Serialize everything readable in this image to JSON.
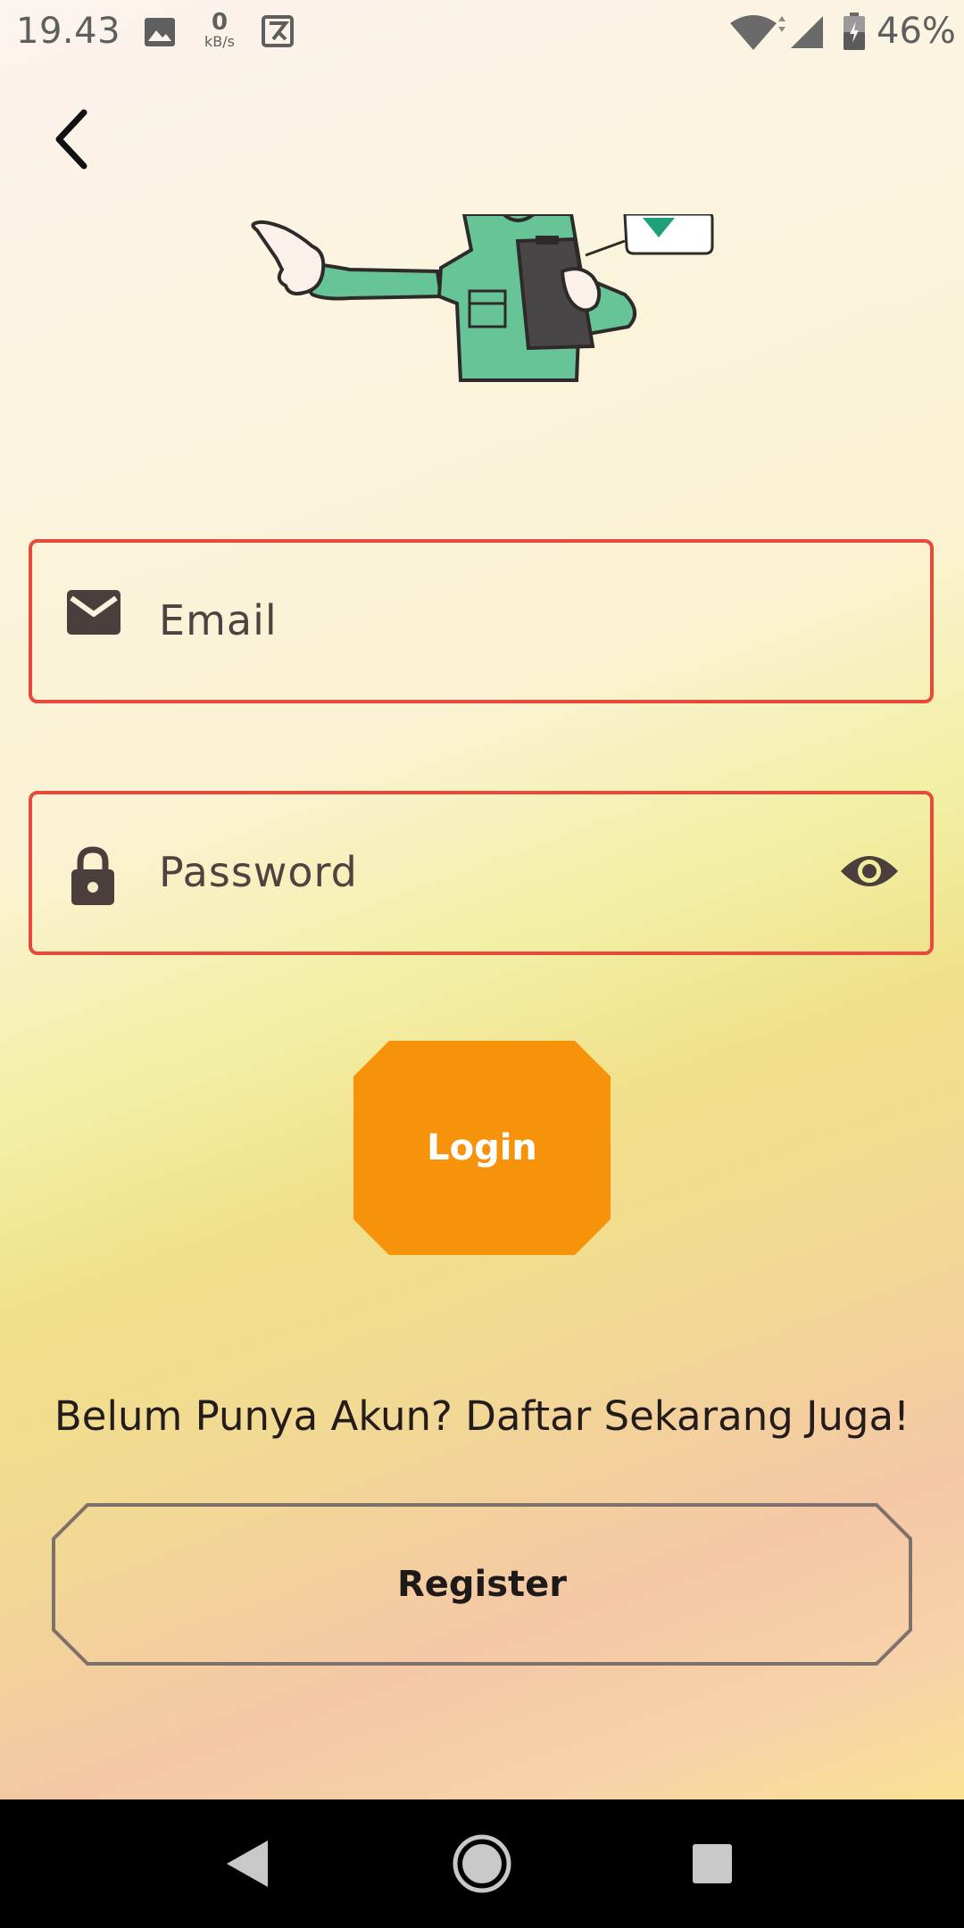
{
  "status_bar": {
    "time": "19.43",
    "net_speed_value": "0",
    "net_speed_unit": "kB/s",
    "battery_percent": "46%",
    "icons": [
      "image-icon",
      "k-icon",
      "wifi-icon",
      "signal-icon",
      "battery-icon"
    ]
  },
  "form": {
    "email_placeholder": "Email",
    "password_placeholder": "Password",
    "field_border_color": "#e64a3a"
  },
  "login": {
    "label": "Login",
    "color": "#f7930a"
  },
  "register": {
    "prompt": "Belum Punya Akun? Daftar Sekarang Juga!",
    "label": "Register"
  }
}
